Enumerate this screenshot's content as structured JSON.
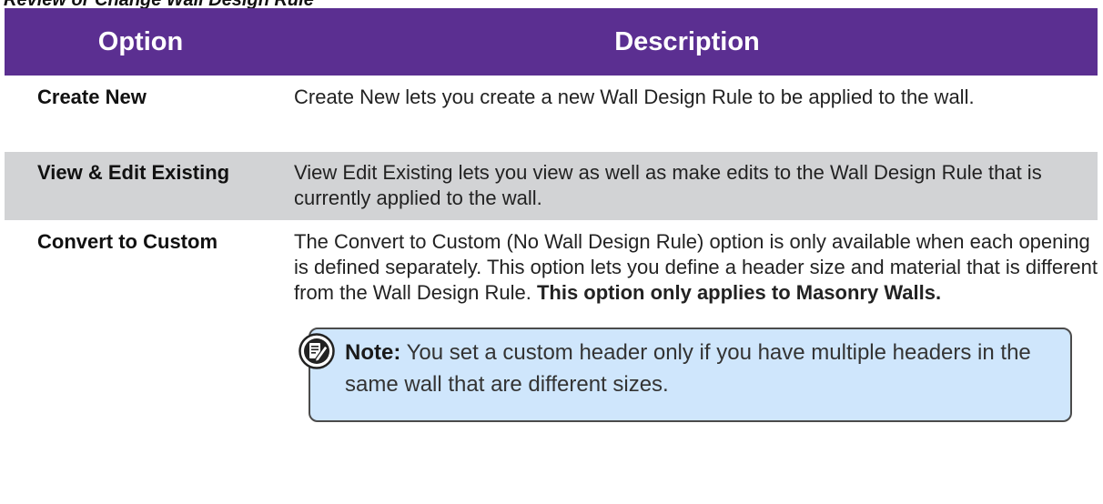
{
  "caption": "Review or Change Wall Design Rule",
  "table": {
    "headers": {
      "option": "Option",
      "description": "Description"
    },
    "rows": [
      {
        "option": "Create New",
        "description": "Create New lets you create a new Wall Design Rule to be applied to the wall."
      },
      {
        "option": "View & Edit Existing",
        "description": "View Edit Existing lets you view as well as make edits to the Wall Design Rule that is currently applied to the wall."
      },
      {
        "option": "Convert to Custom",
        "description": "The Convert to Custom (No Wall Design Rule) option is only available when each opening is defined separately. This option lets you define a header size and material that is different from the Wall Design Rule.",
        "description_bold": "This option only applies to Masonry Walls.",
        "note": {
          "label": "Note:",
          "text": "You set a custom header only if you have multiple headers in the same wall that are different sizes.",
          "icon": "note-pencil-icon"
        }
      }
    ]
  },
  "colors": {
    "header_bg": "#5b2f91",
    "header_text": "#ffffff",
    "alt_row_bg": "#d2d3d5",
    "note_bg": "#cfe6fc",
    "note_border": "#4b4b4b"
  }
}
